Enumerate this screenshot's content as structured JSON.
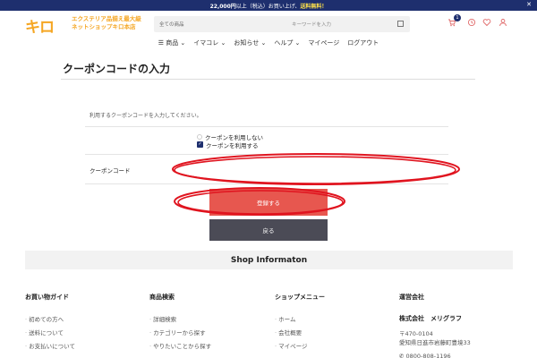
{
  "promo": {
    "prefix": "22,000円",
    "middle": "以上（税込）お買い上げ、",
    "highlight": "送料無料！",
    "close": "✕"
  },
  "logo": {
    "text": "キロ",
    "tagline_1": "エクステリア品揃え最大級",
    "tagline_2": "ネットショップキロ本店"
  },
  "search": {
    "category": "全ての商品",
    "placeholder": "キーワードを入力"
  },
  "header_icons": {
    "cart_count": "1",
    "icons": [
      "cart-icon",
      "history-icon",
      "heart-icon",
      "user-icon"
    ]
  },
  "nav": {
    "items": [
      "☰ 商品 ⌄",
      "イマコレ ⌄",
      "お知らせ ⌄",
      "ヘルプ ⌄",
      "マイページ",
      "ログアウト"
    ]
  },
  "page": {
    "title": "クーポンコードの入力"
  },
  "form": {
    "intro": "利用するクーポンコードを入力してください。",
    "option_no": "クーポンを利用しない",
    "option_yes": "クーポンを利用する",
    "code_label": "クーポンコード",
    "code_value": "",
    "submit_label": "登録する",
    "back_label": "戻る"
  },
  "footer": {
    "heading": "Shop Informaton",
    "col1": {
      "title": "お買い物ガイド",
      "items": [
        "初めての方へ",
        "送料について",
        "お支払いについて"
      ]
    },
    "col2": {
      "title": "商品検索",
      "items": [
        "詳細検索",
        "カテゴリーから探す",
        "やりたいことから探す"
      ]
    },
    "col3": {
      "title": "ショップメニュー",
      "items": [
        "ホーム",
        "会社概要",
        "マイページ"
      ]
    },
    "col4": {
      "title": "運営会社",
      "company": "株式会社　メリグラフ",
      "zip": "〒470-0104",
      "address": "愛知県日進市岩藤町豊境33",
      "tel": "0800-808-1196"
    }
  },
  "colors": {
    "navy": "#1e2f6e",
    "accent": "#f5a623",
    "submit": "#e7574f",
    "back": "#4b4b56",
    "annotation": "#e0141f"
  }
}
